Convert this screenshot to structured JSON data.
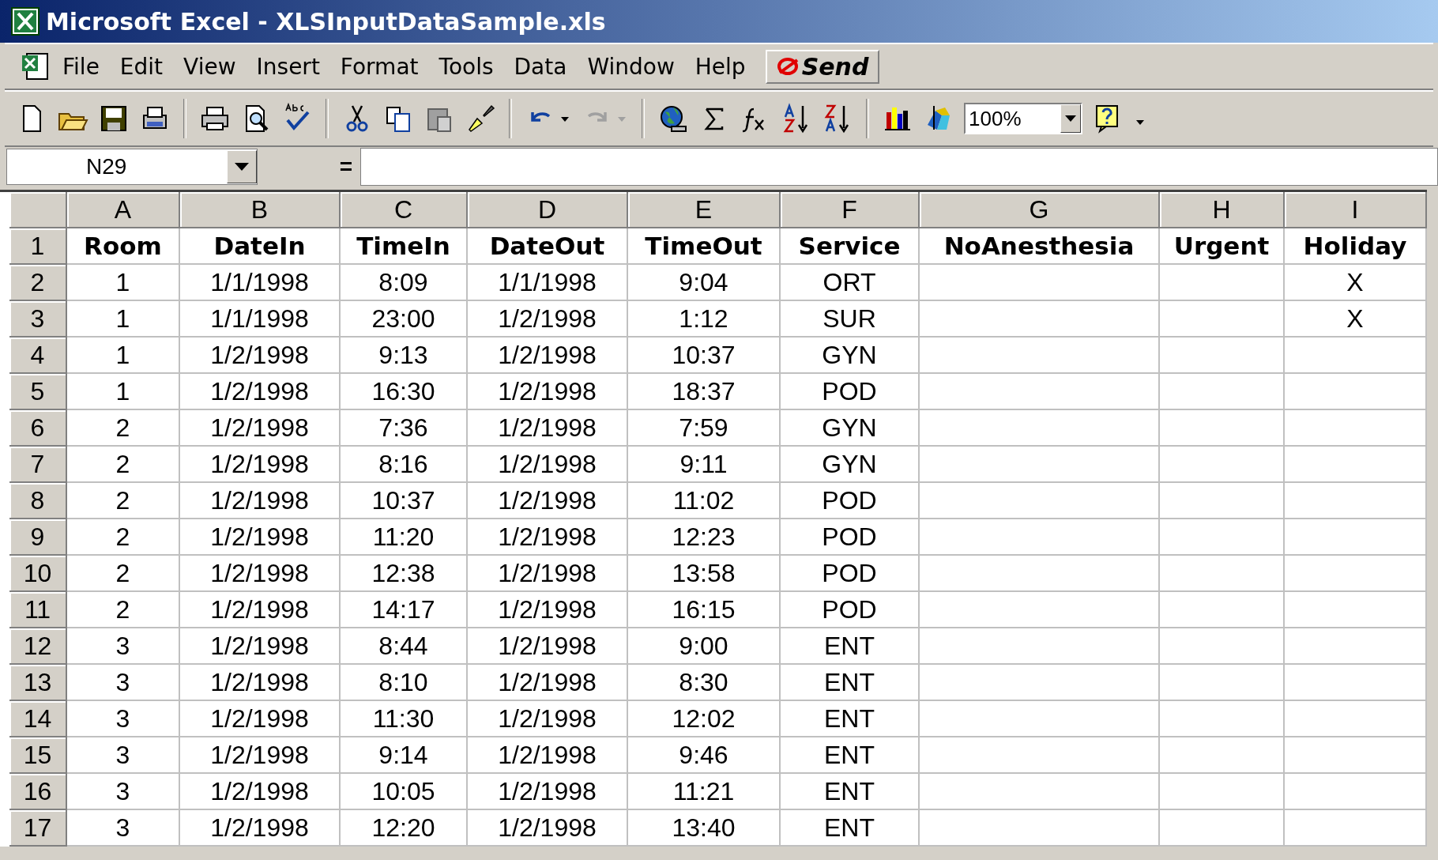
{
  "window": {
    "title": "Microsoft Excel - XLSInputDataSample.xls"
  },
  "menu": [
    "File",
    "Edit",
    "View",
    "Insert",
    "Format",
    "Tools",
    "Data",
    "Window",
    "Help"
  ],
  "send_button": "Send",
  "toolbar": {
    "zoom": "100%"
  },
  "formula_bar": {
    "name_box": "N29",
    "equals": "="
  },
  "columns": [
    "A",
    "B",
    "C",
    "D",
    "E",
    "F",
    "G",
    "H",
    "I"
  ],
  "rows": [
    {
      "number": "1",
      "header": true,
      "cells": {
        "A": "Room",
        "B": "DateIn",
        "C": "TimeIn",
        "D": "DateOut",
        "E": "TimeOut",
        "F": "Service",
        "G": "NoAnesthesia",
        "H": "Urgent",
        "I": "Holiday"
      }
    },
    {
      "number": "2",
      "header": false,
      "cells": {
        "A": "1",
        "B": "1/1/1998",
        "C": "8:09",
        "D": "1/1/1998",
        "E": "9:04",
        "F": "ORT",
        "I": "X"
      }
    },
    {
      "number": "3",
      "header": false,
      "cells": {
        "A": "1",
        "B": "1/1/1998",
        "C": "23:00",
        "D": "1/2/1998",
        "E": "1:12",
        "F": "SUR",
        "I": "X"
      }
    },
    {
      "number": "4",
      "header": false,
      "cells": {
        "A": "1",
        "B": "1/2/1998",
        "C": "9:13",
        "D": "1/2/1998",
        "E": "10:37",
        "F": "GYN"
      }
    },
    {
      "number": "5",
      "header": false,
      "cells": {
        "A": "1",
        "B": "1/2/1998",
        "C": "16:30",
        "D": "1/2/1998",
        "E": "18:37",
        "F": "POD"
      }
    },
    {
      "number": "6",
      "header": false,
      "cells": {
        "A": "2",
        "B": "1/2/1998",
        "C": "7:36",
        "D": "1/2/1998",
        "E": "7:59",
        "F": "GYN"
      }
    },
    {
      "number": "7",
      "header": false,
      "cells": {
        "A": "2",
        "B": "1/2/1998",
        "C": "8:16",
        "D": "1/2/1998",
        "E": "9:11",
        "F": "GYN"
      }
    },
    {
      "number": "8",
      "header": false,
      "cells": {
        "A": "2",
        "B": "1/2/1998",
        "C": "10:37",
        "D": "1/2/1998",
        "E": "11:02",
        "F": "POD"
      }
    },
    {
      "number": "9",
      "header": false,
      "cells": {
        "A": "2",
        "B": "1/2/1998",
        "C": "11:20",
        "D": "1/2/1998",
        "E": "12:23",
        "F": "POD"
      }
    },
    {
      "number": "10",
      "header": false,
      "cells": {
        "A": "2",
        "B": "1/2/1998",
        "C": "12:38",
        "D": "1/2/1998",
        "E": "13:58",
        "F": "POD"
      }
    },
    {
      "number": "11",
      "header": false,
      "cells": {
        "A": "2",
        "B": "1/2/1998",
        "C": "14:17",
        "D": "1/2/1998",
        "E": "16:15",
        "F": "POD"
      }
    },
    {
      "number": "12",
      "header": false,
      "cells": {
        "A": "3",
        "B": "1/2/1998",
        "C": "8:44",
        "D": "1/2/1998",
        "E": "9:00",
        "F": "ENT"
      }
    },
    {
      "number": "13",
      "header": false,
      "cells": {
        "A": "3",
        "B": "1/2/1998",
        "C": "8:10",
        "D": "1/2/1998",
        "E": "8:30",
        "F": "ENT"
      }
    },
    {
      "number": "14",
      "header": false,
      "cells": {
        "A": "3",
        "B": "1/2/1998",
        "C": "11:30",
        "D": "1/2/1998",
        "E": "12:02",
        "F": "ENT"
      }
    },
    {
      "number": "15",
      "header": false,
      "cells": {
        "A": "3",
        "B": "1/2/1998",
        "C": "9:14",
        "D": "1/2/1998",
        "E": "9:46",
        "F": "ENT"
      }
    },
    {
      "number": "16",
      "header": false,
      "cells": {
        "A": "3",
        "B": "1/2/1998",
        "C": "10:05",
        "D": "1/2/1998",
        "E": "11:21",
        "F": "ENT"
      }
    },
    {
      "number": "17",
      "header": false,
      "cells": {
        "A": "3",
        "B": "1/2/1998",
        "C": "12:20",
        "D": "1/2/1998",
        "E": "13:40",
        "F": "ENT"
      }
    }
  ]
}
